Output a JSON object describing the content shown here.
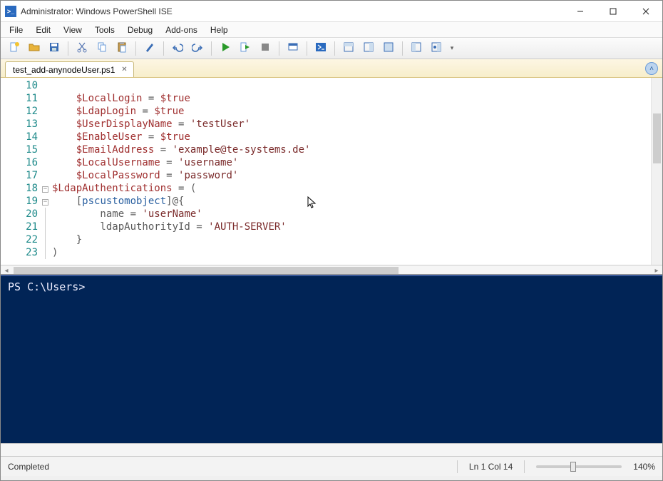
{
  "window": {
    "title": "Administrator: Windows PowerShell ISE"
  },
  "menu": {
    "items": [
      "File",
      "Edit",
      "View",
      "Tools",
      "Debug",
      "Add-ons",
      "Help"
    ]
  },
  "tabs": {
    "active": "test_add-anynodeUser.ps1"
  },
  "code": {
    "lines": [
      {
        "n": 10,
        "fold": "",
        "segments": []
      },
      {
        "n": 11,
        "fold": "",
        "segments": [
          {
            "t": "    ",
            "c": ""
          },
          {
            "t": "$LocalLogin",
            "c": "tok-var"
          },
          {
            "t": " = ",
            "c": "tok-op"
          },
          {
            "t": "$true",
            "c": "tok-var"
          }
        ]
      },
      {
        "n": 12,
        "fold": "",
        "segments": [
          {
            "t": "    ",
            "c": ""
          },
          {
            "t": "$LdapLogin",
            "c": "tok-var"
          },
          {
            "t": " = ",
            "c": "tok-op"
          },
          {
            "t": "$true",
            "c": "tok-var"
          }
        ]
      },
      {
        "n": 13,
        "fold": "",
        "segments": [
          {
            "t": "    ",
            "c": ""
          },
          {
            "t": "$UserDisplayName",
            "c": "tok-var"
          },
          {
            "t": " = ",
            "c": "tok-op"
          },
          {
            "t": "'testUser'",
            "c": "tok-str"
          }
        ]
      },
      {
        "n": 14,
        "fold": "",
        "segments": [
          {
            "t": "    ",
            "c": ""
          },
          {
            "t": "$EnableUser",
            "c": "tok-var"
          },
          {
            "t": " = ",
            "c": "tok-op"
          },
          {
            "t": "$true",
            "c": "tok-var"
          }
        ]
      },
      {
        "n": 15,
        "fold": "",
        "segments": [
          {
            "t": "    ",
            "c": ""
          },
          {
            "t": "$EmailAddress",
            "c": "tok-var"
          },
          {
            "t": " = ",
            "c": "tok-op"
          },
          {
            "t": "'example@te-systems.de'",
            "c": "tok-str"
          }
        ]
      },
      {
        "n": 16,
        "fold": "",
        "segments": [
          {
            "t": "    ",
            "c": ""
          },
          {
            "t": "$LocalUsername",
            "c": "tok-var"
          },
          {
            "t": " = ",
            "c": "tok-op"
          },
          {
            "t": "'username'",
            "c": "tok-str"
          }
        ]
      },
      {
        "n": 17,
        "fold": "",
        "segments": [
          {
            "t": "    ",
            "c": ""
          },
          {
            "t": "$LocalPassword",
            "c": "tok-var"
          },
          {
            "t": " = ",
            "c": "tok-op"
          },
          {
            "t": "'password'",
            "c": "tok-str"
          }
        ]
      },
      {
        "n": 18,
        "fold": "box",
        "segments": [
          {
            "t": "$LdapAuthentications",
            "c": "tok-var"
          },
          {
            "t": " = (",
            "c": "tok-op"
          }
        ]
      },
      {
        "n": 19,
        "fold": "box",
        "segments": [
          {
            "t": "    ",
            "c": ""
          },
          {
            "t": "[",
            "c": "tok-op"
          },
          {
            "t": "pscustomobject",
            "c": "tok-type"
          },
          {
            "t": "]@{",
            "c": "tok-op"
          }
        ]
      },
      {
        "n": 20,
        "fold": "bar",
        "segments": [
          {
            "t": "        name = ",
            "c": "tok-op"
          },
          {
            "t": "'userName'",
            "c": "tok-str"
          }
        ]
      },
      {
        "n": 21,
        "fold": "bar",
        "segments": [
          {
            "t": "        ldapAuthorityId = ",
            "c": "tok-op"
          },
          {
            "t": "'AUTH-SERVER'",
            "c": "tok-str"
          }
        ]
      },
      {
        "n": 22,
        "fold": "bar",
        "segments": [
          {
            "t": "    }",
            "c": "tok-op"
          }
        ]
      },
      {
        "n": 23,
        "fold": "bar",
        "segments": [
          {
            "t": ")",
            "c": "tok-op"
          }
        ]
      }
    ]
  },
  "console": {
    "prompt": "PS C:\\Users>"
  },
  "status": {
    "state": "Completed",
    "position": "Ln 1  Col 14",
    "zoom": "140%"
  }
}
